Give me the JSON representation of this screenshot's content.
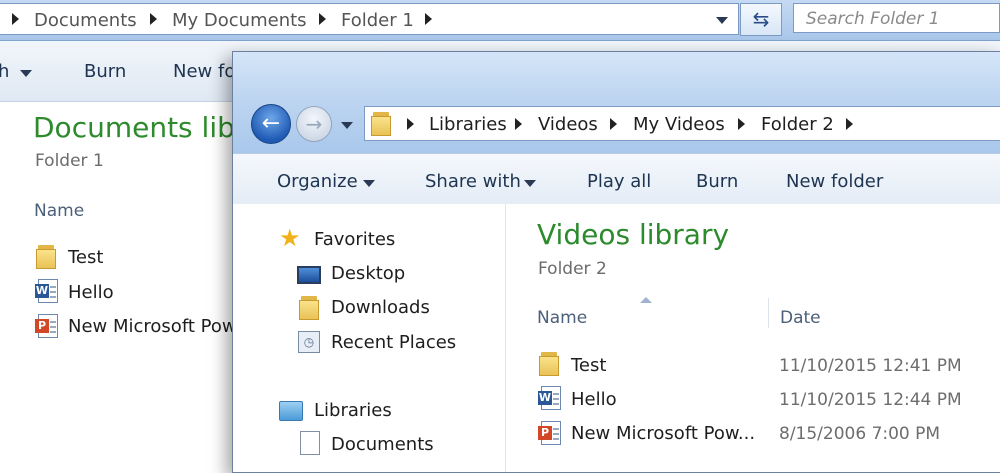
{
  "back_window": {
    "breadcrumbs": [
      "Documents",
      "My Documents",
      "Folder 1"
    ],
    "search_placeholder": "Search Folder 1",
    "toolbar": [
      "h",
      "Burn",
      "New fol"
    ],
    "library_title": "Documents libr",
    "library_subtitle": "Folder 1",
    "column_name": "Name",
    "files": [
      {
        "name": "Test",
        "icon": "folder-icon"
      },
      {
        "name": "Hello",
        "icon": "word-doc-icon"
      },
      {
        "name": "New Microsoft Pow",
        "icon": "powerpoint-icon"
      }
    ]
  },
  "front_window": {
    "breadcrumbs": [
      "Libraries",
      "Videos",
      "My Videos",
      "Folder 2"
    ],
    "toolbar": {
      "organize": "Organize",
      "share_with": "Share with",
      "play_all": "Play all",
      "burn": "Burn",
      "new_folder": "New folder"
    },
    "nav": {
      "favorites": "Favorites",
      "desktop": "Desktop",
      "downloads": "Downloads",
      "recent_places": "Recent Places",
      "libraries": "Libraries",
      "documents": "Documents"
    },
    "library_title": "Videos library",
    "library_subtitle": "Folder 2",
    "columns": {
      "name": "Name",
      "date": "Date"
    },
    "files": [
      {
        "name": "Test",
        "date": "11/10/2015 12:41 PM",
        "icon": "folder-icon"
      },
      {
        "name": "Hello",
        "date": "11/10/2015 12:44 PM",
        "icon": "word-doc-icon"
      },
      {
        "name": "New Microsoft Pow...",
        "date": "8/15/2006 7:00 PM",
        "icon": "powerpoint-icon"
      }
    ]
  },
  "colors": {
    "library_title": "#2d8a2d",
    "chrome_blue": "#bcd4f0",
    "word_blue": "#2b5797",
    "powerpoint_orange": "#d24726"
  }
}
